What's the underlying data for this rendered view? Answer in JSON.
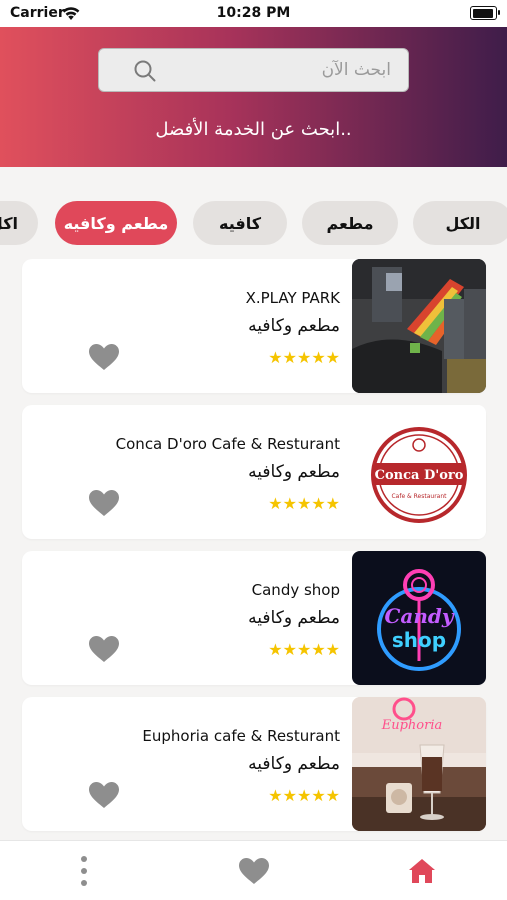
{
  "status_bar": {
    "carrier": "Carrier",
    "time": "10:28 PM"
  },
  "search": {
    "placeholder": "ابحث الآن",
    "value": ""
  },
  "hero": {
    "tagline": "ابحث عن الخدمة الأفضل.."
  },
  "categories": [
    {
      "label": "الكل",
      "active": false
    },
    {
      "label": "مطعم",
      "active": false
    },
    {
      "label": "كافيه",
      "active": false
    },
    {
      "label": "مطعم وكافيه",
      "active": true
    },
    {
      "label": "اكل",
      "active": false
    }
  ],
  "places": [
    {
      "name": "X.PLAY PARK",
      "category": "مطعم وكافيه",
      "stars": "★★★★★",
      "rating": 5
    },
    {
      "name": "Conca D'oro Cafe & Resturant",
      "category": "مطعم وكافيه",
      "stars": "★★★★★",
      "rating": 5,
      "logo_text": "Conca D'oro",
      "logo_sub": "Cafe & Restaurant"
    },
    {
      "name": "Candy shop",
      "category": "مطعم وكافيه",
      "stars": "★★★★★",
      "rating": 5,
      "sign_top": "Candy",
      "sign_bottom": "shop"
    },
    {
      "name": "Euphoria cafe & Resturant",
      "category": "مطعم وكافيه",
      "stars": "★★★★★",
      "rating": 5,
      "sign": "Euphoria"
    }
  ],
  "tabbar": {
    "items": [
      "more-icon",
      "favorites-icon",
      "home-icon"
    ],
    "active": "home-icon"
  },
  "colors": {
    "accent": "#e0485a",
    "gradient_start": "#e0505c",
    "gradient_end": "#3f1d4a",
    "star": "#f5c400",
    "heart": "#8e8e8e"
  }
}
